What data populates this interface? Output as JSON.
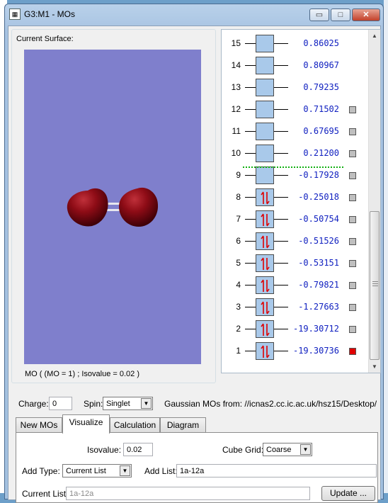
{
  "window": {
    "title": "G3:M1 - MOs",
    "app_icon": "gaussview-icon",
    "controls": {
      "minimize": "▭",
      "maximize": "□",
      "close": "✕"
    }
  },
  "surface": {
    "group_label": "Current Surface:",
    "caption": "MO ( (MO = 1) ; Isovalue = 0.02 )"
  },
  "orbitals": [
    {
      "number": "15",
      "energy": "0.86025",
      "occupied": false,
      "checkbox": false,
      "selected": false
    },
    {
      "number": "14",
      "energy": "0.80967",
      "occupied": false,
      "checkbox": false,
      "selected": false
    },
    {
      "number": "13",
      "energy": "0.79235",
      "occupied": false,
      "checkbox": false,
      "selected": false
    },
    {
      "number": "12",
      "energy": "0.71502",
      "occupied": false,
      "checkbox": true,
      "selected": false
    },
    {
      "number": "11",
      "energy": "0.67695",
      "occupied": false,
      "checkbox": true,
      "selected": false
    },
    {
      "number": "10",
      "energy": "0.21200",
      "occupied": false,
      "checkbox": true,
      "selected": false
    },
    {
      "number": "9",
      "energy": "-0.17928",
      "occupied": false,
      "checkbox": true,
      "selected": false
    },
    {
      "number": "8",
      "energy": "-0.25018",
      "occupied": true,
      "checkbox": true,
      "selected": false
    },
    {
      "number": "7",
      "energy": "-0.50754",
      "occupied": true,
      "checkbox": true,
      "selected": false
    },
    {
      "number": "6",
      "energy": "-0.51526",
      "occupied": true,
      "checkbox": true,
      "selected": false
    },
    {
      "number": "5",
      "energy": "-0.53151",
      "occupied": true,
      "checkbox": true,
      "selected": false
    },
    {
      "number": "4",
      "energy": "-0.79821",
      "occupied": true,
      "checkbox": true,
      "selected": false
    },
    {
      "number": "3",
      "energy": "-1.27663",
      "occupied": true,
      "checkbox": true,
      "selected": false
    },
    {
      "number": "2",
      "energy": "-19.30712",
      "occupied": true,
      "checkbox": true,
      "selected": false
    },
    {
      "number": "1",
      "energy": "-19.30736",
      "occupied": true,
      "checkbox": true,
      "selected": true
    }
  ],
  "settings": {
    "charge_label": "Charge:",
    "charge_value": "0",
    "spin_label": "Spin:",
    "spin_value": "Singlet",
    "source_text": "Gaussian MOs from:  //icnas2.cc.ic.ac.uk/hsz15/Desktop/"
  },
  "tabs": [
    {
      "label": "New MOs",
      "active": false
    },
    {
      "label": "Visualize",
      "active": true
    },
    {
      "label": "Calculation",
      "active": false
    },
    {
      "label": "Diagram",
      "active": false
    }
  ],
  "visualize": {
    "isovalue_label": "Isovalue:",
    "isovalue_value": "0.02",
    "cube_grid_label": "Cube Grid:",
    "cube_grid_value": "Coarse",
    "add_type_label": "Add Type:",
    "add_type_value": "Current List",
    "add_list_label": "Add List:",
    "add_list_value": "1a-12a",
    "current_list_label": "Current List:",
    "current_list_value": "1a-12a",
    "update_button": "Update ..."
  },
  "colors": {
    "viewport_bg": "#7f7fcc",
    "orbital_box": "#a9c9ea",
    "energy_text": "#1020c0",
    "electron_arrow": "#e00000",
    "homo_lumo_divider": "#10b010",
    "selected_checkbox": "#e00000"
  }
}
